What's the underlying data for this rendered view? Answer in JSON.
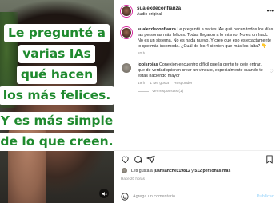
{
  "media": {
    "overlay_lines": [
      "Le pregunté a",
      "varias IAs",
      "qué hacen",
      "los más felices.",
      "Y es más simple",
      "de lo que creen."
    ]
  },
  "post": {
    "username": "sualexdeconfianza",
    "audio": "Audio original"
  },
  "caption": {
    "username": "sualexdeconfianza",
    "text": "Le pregunté a varias IAs qué hacen todos los días las personas más felices. Todas llegaron a lo mismo. No es un hack. No es un sistema. No es nada nuevo. Y creo que eso es exactamente lo que más incomoda. ¿Cuál de los 4 sienten que más les falta? 👇",
    "time": "20 h"
  },
  "comment": {
    "username": "jopisrojas",
    "text": "Conexion-encuentro difícil que la gente te deje entrar, que de verdad quieran crear un vínculo, especialmente cuando te estas haciendo mayor",
    "time": "19 h",
    "likes": "1 Me gusta",
    "reply": "Responder",
    "view_replies": "Ver respuestas (1)"
  },
  "likes": {
    "prefix": "Les gusta a",
    "user": "juansanchez19812",
    "connector": "y",
    "count": "512 personas más"
  },
  "date": "Hace 20 horas",
  "add_comment": {
    "placeholder": "Agrega un comentario...",
    "publish": "Publicar"
  },
  "colors": {
    "overlay_text": "#1f8a2e",
    "publish": "#b2dffc"
  }
}
